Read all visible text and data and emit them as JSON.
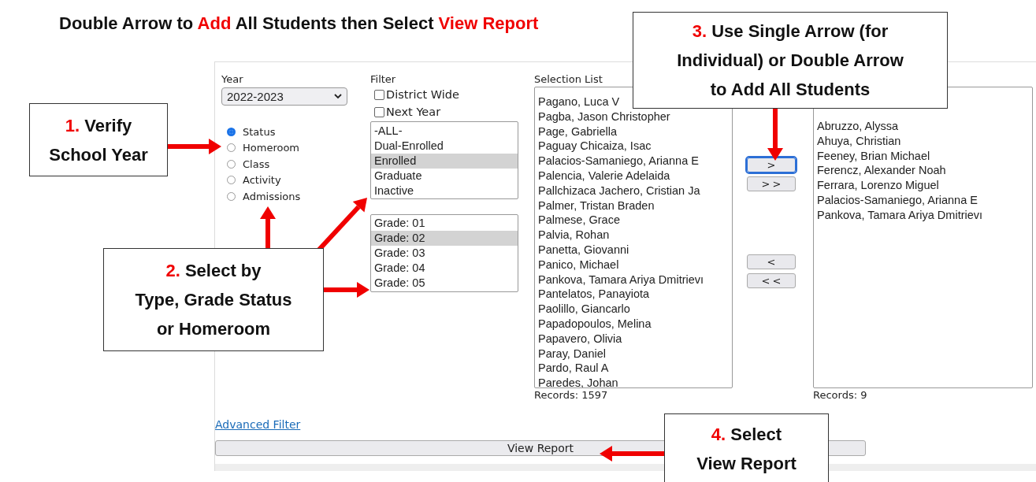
{
  "instruction": [
    {
      "text": "Double Arrow to ",
      "highlight": false
    },
    {
      "text": "Add",
      "highlight": true
    },
    {
      "text": " All Students then Select ",
      "highlight": false
    },
    {
      "text": "View Report",
      "highlight": true
    }
  ],
  "form": {
    "year": {
      "label": "Year",
      "value": "2022-2023"
    },
    "select_by": [
      {
        "label": "Status",
        "selected": true
      },
      {
        "label": "Homeroom",
        "selected": false
      },
      {
        "label": "Class",
        "selected": false
      },
      {
        "label": "Activity",
        "selected": false
      },
      {
        "label": "Admissions",
        "selected": false
      }
    ],
    "filter": {
      "label": "Filter",
      "checkboxes": [
        {
          "label": "District Wide",
          "checked": false
        },
        {
          "label": "Next Year",
          "checked": false
        }
      ]
    },
    "status_list": [
      {
        "label": "-ALL-",
        "selected": false
      },
      {
        "label": "Dual-Enrolled",
        "selected": false
      },
      {
        "label": "Enrolled",
        "selected": true
      },
      {
        "label": "Graduate",
        "selected": false
      },
      {
        "label": "Inactive",
        "selected": false
      }
    ],
    "grade_list": [
      {
        "label": "Grade: 01",
        "selected": false
      },
      {
        "label": "Grade: 02",
        "selected": true
      },
      {
        "label": "Grade: 03",
        "selected": false
      },
      {
        "label": "Grade: 04",
        "selected": false
      },
      {
        "label": "Grade: 05",
        "selected": false
      }
    ],
    "selection_list": {
      "label": "Selection List",
      "items": [
        "Pagano, Luca V",
        "Pagba, Jason Christopher",
        "Page, Gabriella",
        "Paguay Chicaiza, Isac",
        "Palacios-Samaniego, Arianna E",
        "Palencia, Valerie Adelaida",
        "Pallchizaca Jachero, Cristian Ja",
        "Palmer, Tristan Braden",
        "Palmese, Grace",
        "Palvia, Rohan",
        "Panetta, Giovanni",
        "Panico, Michael",
        "Pankova, Tamara Ariya Dmitrievı",
        "Pantelatos, Panayiota",
        "Paolillo, Giancarlo",
        "Papadopoulos, Melina",
        "Papavero, Olivia",
        "Paray, Daniel",
        "Pardo, Raul A",
        "Paredes, Johan"
      ],
      "records": "Records: 1597"
    },
    "transfer_buttons": [
      {
        "label": ">",
        "focused": true
      },
      {
        "label": ">>",
        "focused": false
      },
      {
        "label": "<",
        "focused": false
      },
      {
        "label": "<<",
        "focused": false
      }
    ],
    "selected_list": {
      "items": [
        "Abruzzo, Alyssa",
        "Ahuya, Christian",
        "Feeney, Brian Michael",
        "Ferencz, Alexander Noah",
        "Ferrara, Lorenzo Miguel",
        "Palacios-Samaniego, Arianna E",
        "Pankova, Tamara Ariya Dmitrievı"
      ],
      "records": "Records: 9"
    },
    "advanced_filter": "Advanced Filter",
    "view_report": "View Report"
  },
  "callouts": [
    {
      "number": "1.",
      "lines": [
        "Verify",
        "School Year"
      ]
    },
    {
      "number": "2.",
      "lines": [
        "Select by",
        "Type, Grade Status",
        "or Homeroom"
      ]
    },
    {
      "number": "3.",
      "lines": [
        "Use Single Arrow (for",
        "Individual) or Double Arrow",
        "to Add All Students"
      ]
    },
    {
      "number": "4.",
      "lines": [
        "Select",
        "View Report"
      ]
    }
  ]
}
